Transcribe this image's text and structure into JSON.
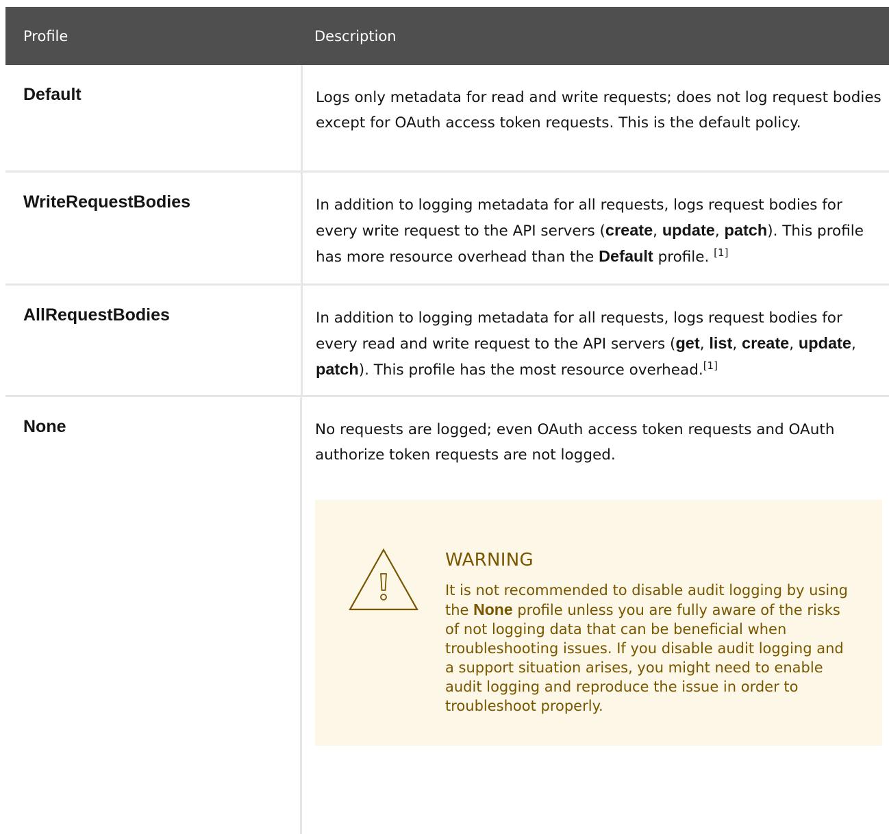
{
  "header": {
    "col_profile": "Profile",
    "col_description": "Description"
  },
  "rows": [
    {
      "name": "Default",
      "desc_1": "Logs only metadata for read and write requests; does not log request bodies except for OAuth access token requests. This is the default policy."
    },
    {
      "name": "WriteRequestBodies",
      "desc_a": "In addition to logging metadata for all requests, logs request bodies for every write request to the API servers (",
      "kw_create": "create",
      "kw_update": "update",
      "kw_patch": "patch",
      "desc_b": "). This profile has more resource overhead than the ",
      "kw_default": "Default",
      "desc_c": " profile.",
      "footnote": "[1]"
    },
    {
      "name": "AllRequestBodies",
      "desc_a": "In addition to logging metadata for all requests, logs request bodies for every read and write request to the API servers (",
      "kw_get": "get",
      "kw_list": "list",
      "kw_create": "create",
      "kw_update": "update",
      "kw_patch": "patch",
      "desc_b": "). This profile has the most resource overhead.",
      "footnote": "[1]"
    },
    {
      "name": "None",
      "desc_1": "No requests are logged; even OAuth access token requests and OAuth authorize token requests are not logged."
    }
  ],
  "warning": {
    "icon": "warning-triangle-icon",
    "title": "WARNING",
    "text_a": "It is not recommended to disable audit logging by using the ",
    "kw_none": "None",
    "text_b": " profile unless you are fully aware of the risks of not logging data that can be beneficial when troubleshooting issues. If you disable audit logging and a support situation arises, you might need to enable audit logging and reproduce the issue in order to troubleshoot properly."
  },
  "colors": {
    "header_bg": "#4f4f4f",
    "warning_bg": "#fdf7e7",
    "warning_text": "#795600"
  }
}
